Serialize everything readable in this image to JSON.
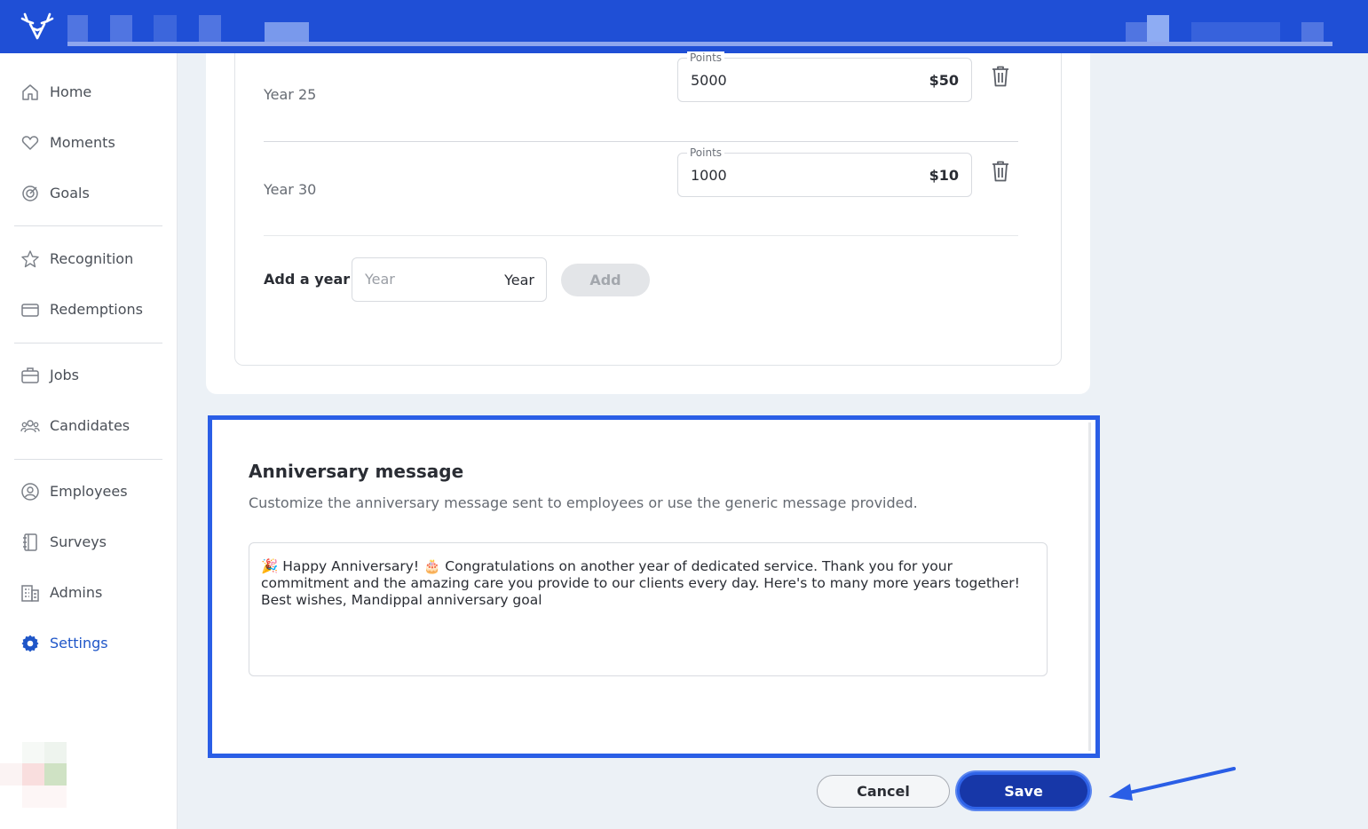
{
  "sidebar": {
    "items": [
      {
        "label": "Home",
        "icon": "home-icon"
      },
      {
        "label": "Moments",
        "icon": "heart-icon"
      },
      {
        "label": "Goals",
        "icon": "target-icon"
      },
      {
        "label": "Recognition",
        "icon": "star-icon"
      },
      {
        "label": "Redemptions",
        "icon": "card-icon"
      },
      {
        "label": "Jobs",
        "icon": "briefcase-icon"
      },
      {
        "label": "Candidates",
        "icon": "people-icon"
      },
      {
        "label": "Employees",
        "icon": "user-circle-icon"
      },
      {
        "label": "Surveys",
        "icon": "notebook-icon"
      },
      {
        "label": "Admins",
        "icon": "building-icon"
      },
      {
        "label": "Settings",
        "icon": "gear-icon",
        "active": true
      }
    ]
  },
  "milestones": {
    "rows": [
      {
        "year_label": "Year 25",
        "points_label": "Points",
        "points_value": "5000",
        "money": "$50"
      },
      {
        "year_label": "Year 30",
        "points_label": "Points",
        "points_value": "1000",
        "money": "$10"
      }
    ],
    "add_label": "Add a year",
    "year_placeholder": "Year",
    "year_suffix": "Year",
    "add_button": "Add"
  },
  "anniversary": {
    "title": "Anniversary message",
    "description": "Customize the anniversary message sent to employees or use the generic message provided.",
    "message": "🎉 Happy Anniversary! 🎂 Congratulations on another year of dedicated service. Thank you for your commitment and the amazing care you provide to our clients every day. Here's to many more years together! Best wishes, Mandippal anniversary goal"
  },
  "actions": {
    "cancel": "Cancel",
    "save": "Save"
  },
  "colors": {
    "topbar": "#1f4fd6",
    "accent": "#1f56c8",
    "save_bg": "#1737a8",
    "highlight_border": "#2a5ee6"
  }
}
